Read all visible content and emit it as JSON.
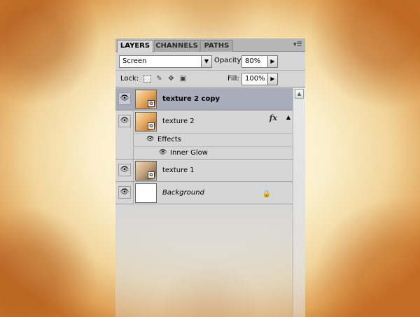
{
  "tabs": [
    {
      "label": "LAYERS",
      "active": true
    },
    {
      "label": "CHANNELS",
      "active": false
    },
    {
      "label": "PATHS",
      "active": false
    }
  ],
  "blend_mode": "Screen",
  "opacity": {
    "label": "Opacity:",
    "value": "80%"
  },
  "lock": {
    "label": "Lock:"
  },
  "fill": {
    "label": "Fill:",
    "value": "100%"
  },
  "layers": [
    {
      "name": "texture 2 copy",
      "selected": true,
      "visible": true
    },
    {
      "name": "texture 2",
      "selected": false,
      "visible": true,
      "has_effects": true,
      "fx_label": "fx",
      "effects_label": "Effects",
      "effects": [
        "Inner Glow"
      ]
    },
    {
      "name": "texture 1",
      "selected": false,
      "visible": true
    },
    {
      "name": "Background",
      "selected": false,
      "visible": true,
      "locked": true
    }
  ],
  "icons": {
    "eye": "eye-icon",
    "panel_menu": "panel-menu-icon",
    "lock_transparency": "lock-transparent-pixels-icon",
    "lock_image": "lock-image-pixels-icon",
    "lock_position": "lock-position-icon",
    "lock_all": "lock-all-icon"
  },
  "colors": {
    "selected_layer": "#a9acbb",
    "panel": "#d6d6d6"
  }
}
